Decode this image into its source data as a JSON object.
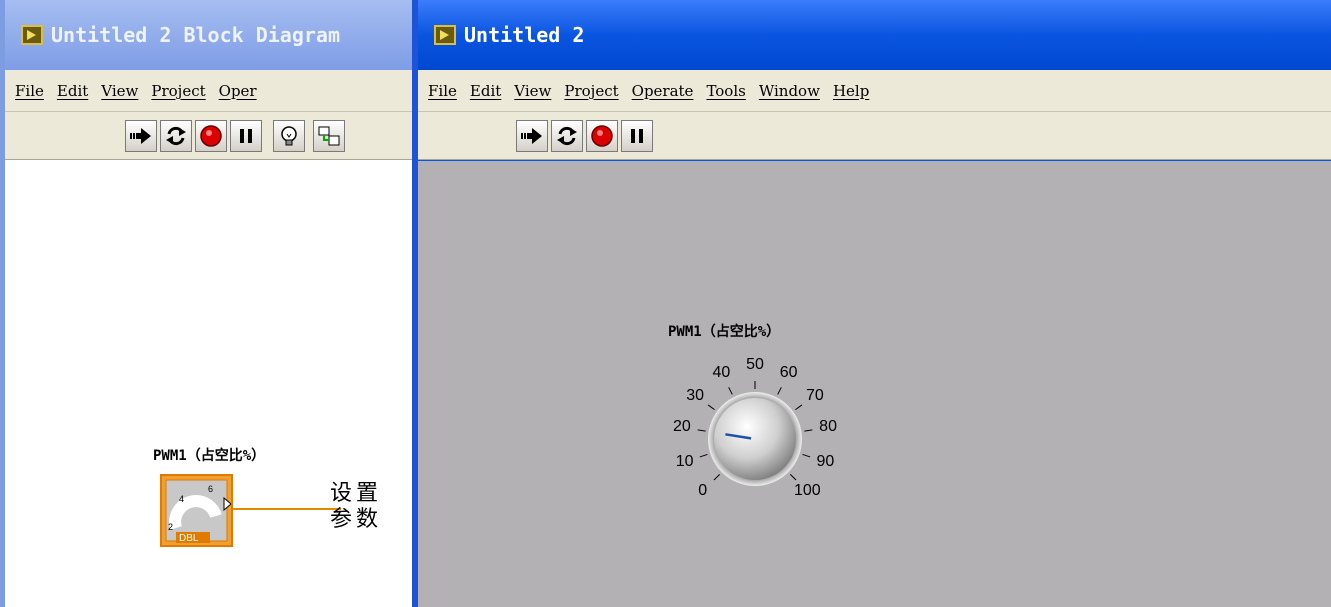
{
  "block_diagram": {
    "title": "Untitled 2 Block Diagram",
    "menu": [
      "File",
      "Edit",
      "View",
      "Project",
      "Oper"
    ],
    "toolbar_icons": [
      "run-arrow-icon",
      "run-continuously-icon",
      "abort-icon",
      "pause-icon",
      "highlight-execution-icon",
      "retain-wire-values-icon"
    ],
    "terminal_label": "PWM1（占空比%）",
    "terminal_type": "DBL",
    "terminal_scale": [
      "2",
      "4",
      "6"
    ],
    "note_line1": "设置",
    "note_line2": "参数"
  },
  "front_panel": {
    "title": "Untitled 2",
    "menu": [
      "File",
      "Edit",
      "View",
      "Project",
      "Operate",
      "Tools",
      "Window",
      "Help"
    ],
    "toolbar_icons": [
      "run-arrow-icon",
      "run-continuously-icon",
      "abort-icon",
      "pause-icon"
    ],
    "knob_label": "PWM1（占空比%）",
    "knob_scale": [
      "0",
      "10",
      "20",
      "30",
      "40",
      "50",
      "60",
      "70",
      "80",
      "90",
      "100"
    ],
    "knob_value": 20
  },
  "colors": {
    "fp_titlebar": "#0a55e0",
    "bd_titlebar": "#8fa9ea",
    "panel_bg": "#b4b1b4",
    "terminal_orange": "#e07a00",
    "wire": "#e08a00",
    "needle": "#1f4fa8"
  }
}
